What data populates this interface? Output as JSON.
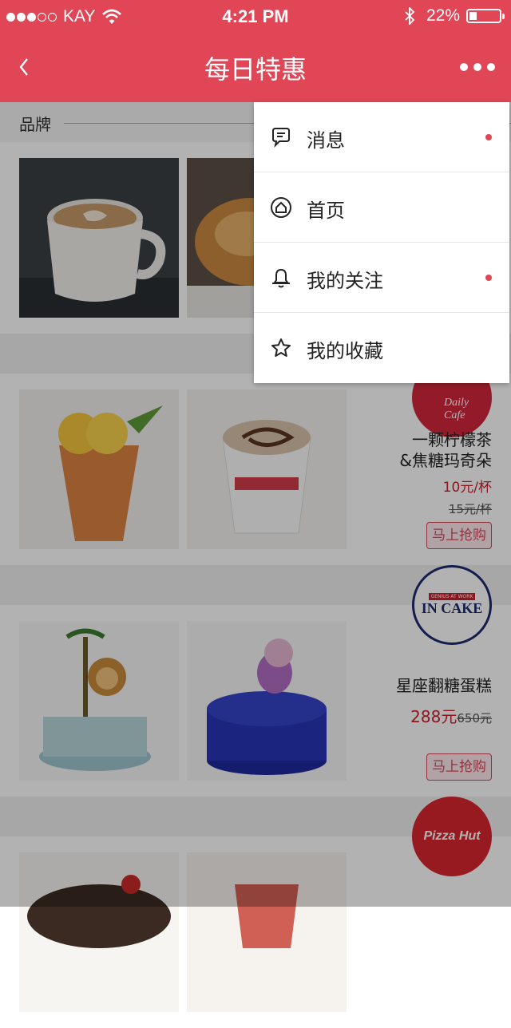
{
  "status_bar": {
    "carrier": "KAY",
    "time": "4:21 PM",
    "battery": "22%",
    "battery_level": 0.22
  },
  "nav": {
    "title": "每日特惠",
    "back_icon": "chevron-left-icon",
    "more_icon": "more-dots-icon"
  },
  "section": {
    "brand_label": "品牌"
  },
  "products": [
    {
      "name_line1": "一颗柠檬茶",
      "name_line2": "&焦糖玛奇朵",
      "price": "10元/杯",
      "old_price": "15元/杯",
      "buy_label": "马上抢购",
      "logo_text": "Daily Cafe"
    },
    {
      "name_line1": "星座翻糖蛋糕",
      "price": "288元",
      "old_price": "650元",
      "buy_label": "马上抢购",
      "logo_text": "IN CAKE",
      "logo_sub": "GENIUS AT WORK"
    },
    {
      "logo_text": "Pizza Hut"
    }
  ],
  "menu": {
    "items": [
      {
        "label": "消息",
        "icon": "chat-bubble-icon",
        "has_dot": true
      },
      {
        "label": "首页",
        "icon": "home-icon",
        "has_dot": false
      },
      {
        "label": "我的关注",
        "icon": "bell-icon",
        "has_dot": true
      },
      {
        "label": "我的收藏",
        "icon": "star-icon",
        "has_dot": false
      }
    ]
  },
  "colors": {
    "brand": "#e04656",
    "price": "#c7202e"
  }
}
